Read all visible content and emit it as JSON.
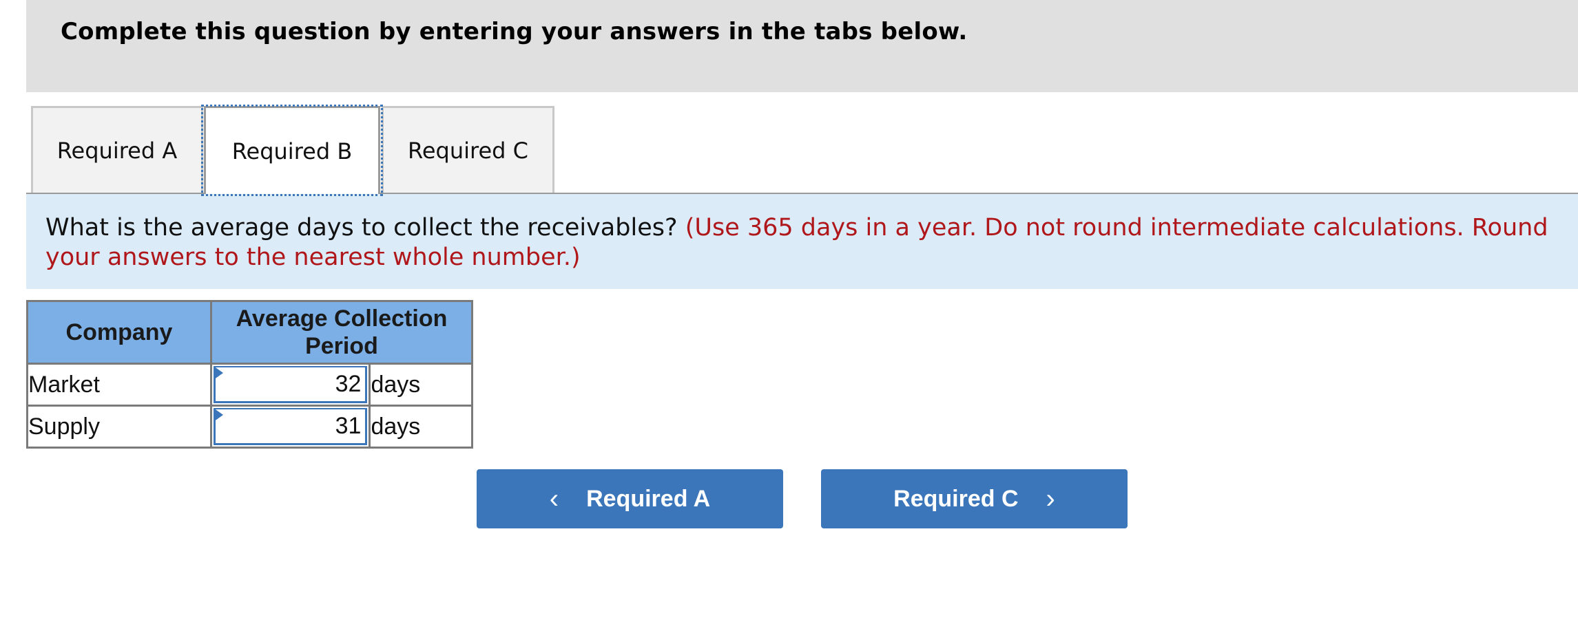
{
  "header": {
    "title": "Complete this question by entering your answers in the tabs below."
  },
  "tabs": [
    {
      "label": "Required A",
      "active": false
    },
    {
      "label": "Required B",
      "active": true
    },
    {
      "label": "Required C",
      "active": false
    }
  ],
  "instructions": {
    "question": "What is the average days to collect the receivables?",
    "note": "(Use 365 days in a year. Do not round intermediate calculations. Round your answers to the nearest whole number.)"
  },
  "table": {
    "headers": [
      "Company",
      "Average Collection Period"
    ],
    "rows": [
      {
        "company": "Market",
        "value": "32",
        "unit": "days"
      },
      {
        "company": "Supply",
        "value": "31",
        "unit": "days"
      }
    ]
  },
  "navigation": {
    "prev_label": "Required A",
    "next_label": "Required C",
    "prev_icon": "chevron-left-icon",
    "next_icon": "chevron-right-icon"
  },
  "colors": {
    "accent": "#3b76bb",
    "table_header": "#7bafe5",
    "instruction_bg": "#dbebf8",
    "note_red": "#b0171b",
    "header_bg": "#e0e0e0"
  }
}
